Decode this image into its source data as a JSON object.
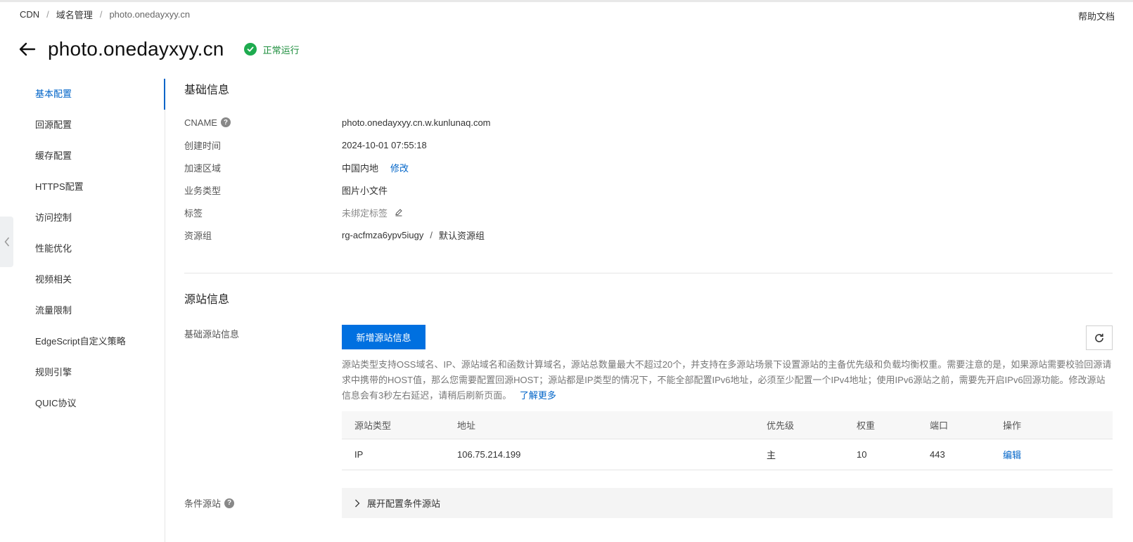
{
  "breadcrumb": {
    "root": "CDN",
    "level2": "域名管理",
    "current": "photo.onedayxyy.cn"
  },
  "help": "帮助文档",
  "title": "photo.onedayxyy.cn",
  "status": "正常运行",
  "sidenav": [
    {
      "label": "基本配置",
      "active": true
    },
    {
      "label": "回源配置"
    },
    {
      "label": "缓存配置"
    },
    {
      "label": "HTTPS配置"
    },
    {
      "label": "访问控制"
    },
    {
      "label": "性能优化"
    },
    {
      "label": "视频相关"
    },
    {
      "label": "流量限制"
    },
    {
      "label": "EdgeScript自定义策略"
    },
    {
      "label": "规则引擎"
    },
    {
      "label": "QUIC协议"
    }
  ],
  "basic": {
    "title": "基础信息",
    "cname_label": "CNAME",
    "cname_value": "photo.onedayxyy.cn.w.kunlunaq.com",
    "created_label": "创建时间",
    "created_value": "2024-10-01 07:55:18",
    "region_label": "加速区域",
    "region_value": "中国内地",
    "region_edit": "修改",
    "biz_label": "业务类型",
    "biz_value": "图片小文件",
    "tag_label": "标签",
    "tag_value": "未绑定标签",
    "rg_label": "资源组",
    "rg_id": "rg-acfmza6ypv5iugy",
    "rg_sep": "/",
    "rg_name": "默认资源组"
  },
  "origin": {
    "title": "源站信息",
    "basic_label": "基础源站信息",
    "add_button": "新增源站信息",
    "desc": "源站类型支持OSS域名、IP、源站域名和函数计算域名，源站总数量最大不超过20个，并支持在多源站场景下设置源站的主备优先级和负载均衡权重。需要注意的是，如果源站需要校验回源请求中携带的HOST值，那么您需要配置回源HOST；源站都是IP类型的情况下，不能全部配置IPv6地址，必须至少配置一个IPv4地址；使用IPv6源站之前，需要先开启IPv6回源功能。修改源站信息会有3秒左右延迟，请稍后刷新页面。",
    "learn_more": "了解更多",
    "columns": [
      "源站类型",
      "地址",
      "优先级",
      "权重",
      "端口",
      "操作"
    ],
    "rows": [
      {
        "type": "IP",
        "address": "106.75.214.199",
        "priority": "主",
        "weight": "10",
        "port": "443",
        "action": "编辑"
      }
    ],
    "cond_label": "条件源站",
    "cond_expand": "展开配置条件源站"
  },
  "colors": {
    "accent": "#0064c8",
    "success": "#1eab4f",
    "button": "#0070e0"
  }
}
